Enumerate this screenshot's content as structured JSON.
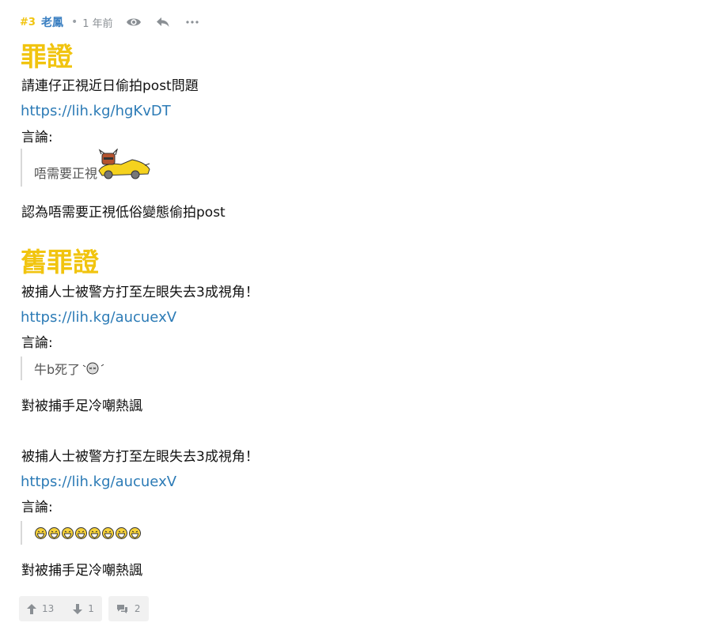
{
  "post": {
    "floor": "#3",
    "author": "老鳳",
    "separator": "•",
    "time": "1 年前"
  },
  "sections": [
    {
      "title": "罪證",
      "line1": "請連仔正視近日偷拍post問題",
      "link": "https://lih.kg/hgKvDT",
      "remarks_label": "言論:",
      "quote": "唔需要正視",
      "comment": "認為唔需要正視低俗變態偷拍post"
    },
    {
      "title": "舊罪證",
      "line1": "被捕人士被警方打至左眼失去3成視角！",
      "link": "https://lih.kg/aucuexV",
      "remarks_label": "言論:",
      "quote": "牛b死了",
      "comment": "對被捕手足冷嘲熱諷"
    },
    {
      "line1": "被捕人士被警方打至左眼失去3成視角！",
      "link": "https://lih.kg/aucuexV",
      "remarks_label": "言論:",
      "quote_emoji_count": 8,
      "comment": "對被捕手足冷嘲熱諷"
    }
  ],
  "footer": {
    "upvotes": "13",
    "downvotes": "1",
    "replies": "2"
  },
  "colors": {
    "title": "#f1c40f",
    "link": "#2c7bb6",
    "author": "#3a7fc1"
  }
}
